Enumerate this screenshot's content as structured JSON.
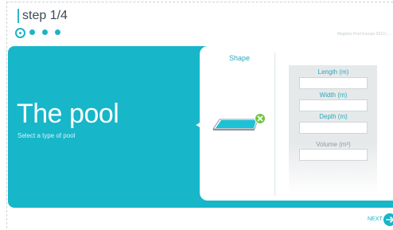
{
  "wizard": {
    "step_label": "step 1/4",
    "steps_total": 4,
    "current_step": 1,
    "brand_text": "Magiline Pool Europe 2010 | ..."
  },
  "intro": {
    "title": "The pool",
    "subtitle": "Select a type of pool"
  },
  "shape": {
    "label": "Shape",
    "selected_icon": "rectangle-pool-icon",
    "remove_icon": "remove-x-icon"
  },
  "dimensions": {
    "length": {
      "label": "Length (m)",
      "value": ""
    },
    "width": {
      "label": "Width (m)",
      "value": ""
    },
    "depth": {
      "label": "Depth (m)",
      "value": ""
    },
    "volume": {
      "label": "Volume (m³)",
      "value": ""
    }
  },
  "footer": {
    "next_label": "NEXT",
    "next_icon": "arrow-right-icon"
  },
  "colors": {
    "accent": "#17b6c9",
    "form_bg": "#e6e9ea",
    "text_dark": "#3d4a55"
  }
}
